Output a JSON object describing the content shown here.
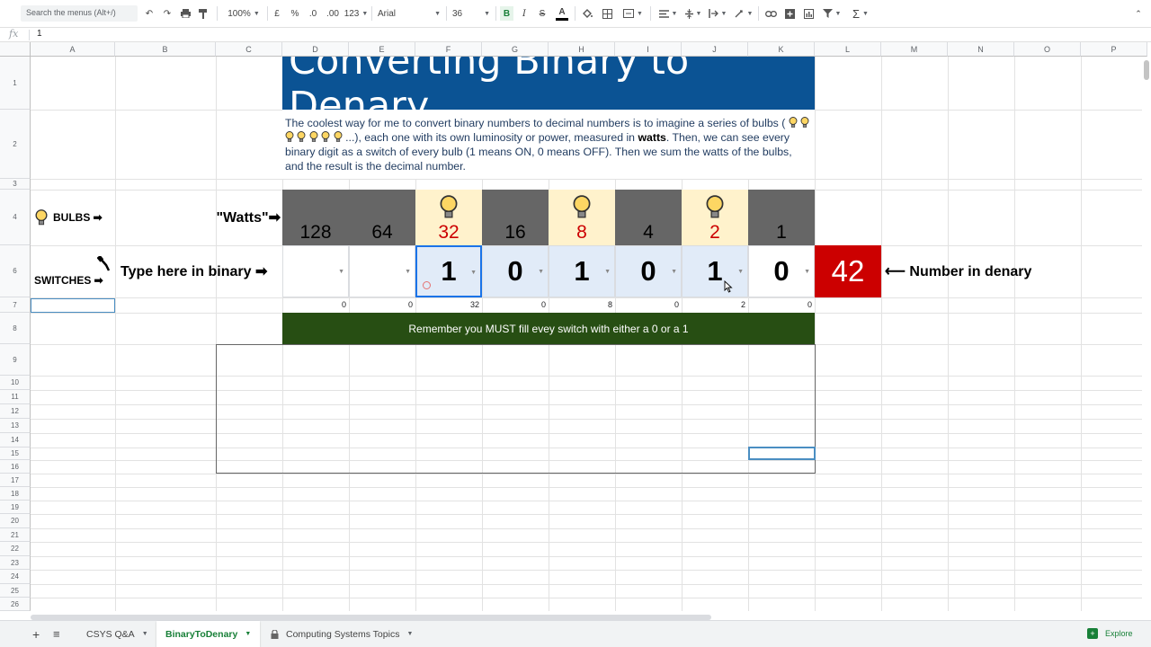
{
  "toolbar": {
    "search_placeholder": "Search the menus (Alt+/)",
    "zoom": "100%",
    "currency": "£",
    "percent": "%",
    "decimal_dec": ".0",
    "decimal_inc": ".00",
    "format_more": "123",
    "font": "Arial",
    "font_size": "36",
    "bold": "B",
    "italic": "I",
    "strike": "S",
    "text_color": "A"
  },
  "formula_bar": {
    "fx": "fx",
    "value": "1"
  },
  "columns": [
    "A",
    "B",
    "C",
    "D",
    "E",
    "F",
    "G",
    "H",
    "I",
    "J",
    "K",
    "L",
    "M",
    "N",
    "O",
    "P"
  ],
  "rows": [
    "1",
    "2",
    "3",
    "4",
    "6",
    "7",
    "8",
    "9",
    "10",
    "11",
    "12",
    "13",
    "14",
    "15",
    "16",
    "17",
    "18",
    "19",
    "20",
    "21",
    "22",
    "23",
    "24",
    "25",
    "26"
  ],
  "sheet": {
    "title": "Converting Binary to Denary",
    "description_1": "The coolest way for me to convert binary numbers to decimal numbers is to imagine a series of bulbs (",
    "description_2": " ...), each one with its own luminosity or power, measured in ",
    "description_bold": "watts",
    "description_3": ". Then, we can see every binary digit as a switch of every bulb (1 means ON, 0 means OFF). Then we sum the watts of the bulbs, and the result is the decimal number.",
    "bulbs_label": "BULBS ➡",
    "watts_label": "\"Watts\"➡",
    "switches_label": "SWITCHES ➡",
    "type_here_label": "Type here in binary ➡",
    "watts": [
      {
        "value": "128",
        "on": false
      },
      {
        "value": "64",
        "on": false
      },
      {
        "value": "32",
        "on": true
      },
      {
        "value": "16",
        "on": false
      },
      {
        "value": "8",
        "on": true
      },
      {
        "value": "4",
        "on": false
      },
      {
        "value": "2",
        "on": true
      },
      {
        "value": "1",
        "on": false
      }
    ],
    "switches": [
      "",
      "",
      "1",
      "0",
      "1",
      "0",
      "1",
      "0"
    ],
    "contributions": [
      "0",
      "0",
      "32",
      "0",
      "8",
      "0",
      "2",
      "0"
    ],
    "result": "42",
    "result_label": "⟵ Number in denary",
    "remember": "Remember you MUST fill evey switch with either a 0 or a 1"
  },
  "tabs": {
    "add": "+",
    "list": "≡",
    "items": [
      "CSYS Q&A",
      "BinaryToDenary",
      "Computing Systems Topics"
    ],
    "explore": "Explore"
  },
  "colors": {
    "title_bg": "#0b5394",
    "bulb_off_bg": "#666666",
    "bulb_on_bg": "#fff2cc",
    "result_bg": "#cc0000",
    "remember_bg": "#274e13"
  }
}
